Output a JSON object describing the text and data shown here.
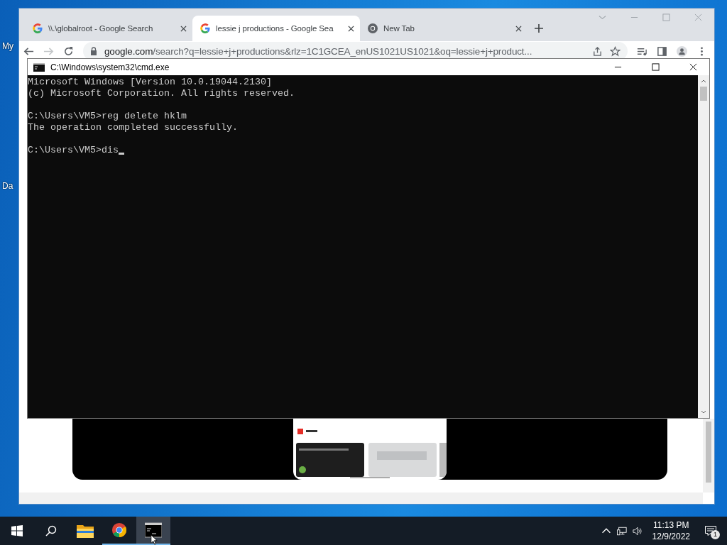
{
  "desktop": {
    "icon_labels": [
      "My",
      "Da"
    ]
  },
  "browser": {
    "tabs": [
      {
        "title": "\\\\.\\globalroot - Google Search",
        "kind": "google",
        "selected": false
      },
      {
        "title": "lessie j productions - Google Sea",
        "kind": "google",
        "selected": true
      },
      {
        "title": "New Tab",
        "kind": "chrome",
        "selected": false
      }
    ],
    "address": {
      "host": "google.com",
      "path": "/search?q=lessie+j+productions&rlz=1C1GCEA_enUS1021US1021&oq=lessie+j+product..."
    }
  },
  "console": {
    "title": "C:\\Windows\\system32\\cmd.exe",
    "blocks": [
      [
        "Microsoft Windows [Version 10.0.19044.2130]",
        "(c) Microsoft Corporation. All rights reserved."
      ],
      [
        "C:\\Users\\VM5>reg delete hklm",
        "The operation completed successfully."
      ]
    ],
    "prompt": "C:\\Users\\VM5>dis"
  },
  "taskbar": {
    "apps": [
      {
        "kind": "explorer",
        "active": false,
        "running": false
      },
      {
        "kind": "chrome",
        "active": false,
        "running": true
      },
      {
        "kind": "console",
        "active": true,
        "running": true
      }
    ],
    "time": "11:13 PM",
    "date": "12/9/2022",
    "notifications": "1"
  }
}
